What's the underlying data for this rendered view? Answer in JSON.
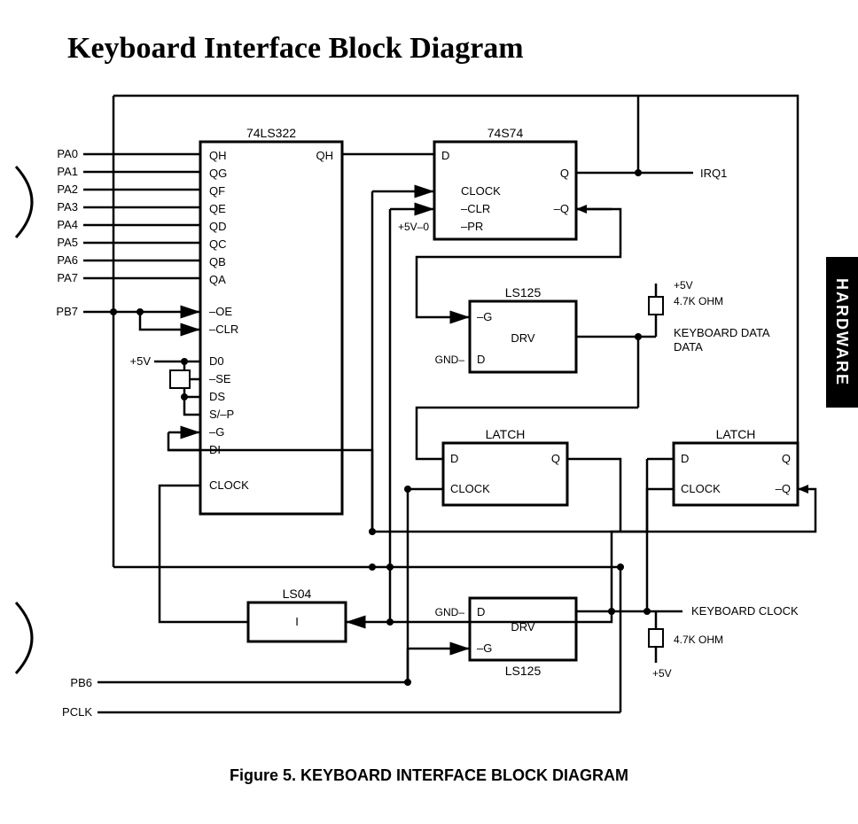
{
  "title": "Keyboard Interface Block Diagram",
  "caption_prefix": "Figure 5.  ",
  "caption_main": "KEYBOARD INTERFACE BLOCK DIAGRAM",
  "side_tab": "HARDWARE",
  "signals": {
    "pa0": "PA0",
    "pa1": "PA1",
    "pa2": "PA2",
    "pa3": "PA3",
    "pa4": "PA4",
    "pa5": "PA5",
    "pa6": "PA6",
    "pa7": "PA7",
    "pb7": "PB7",
    "pb6": "PB6",
    "pclk": "PCLK",
    "irq1": "IRQ1",
    "kb_data": "KEYBOARD\nDATA",
    "kb_clock": "KEYBOARD CLOCK",
    "p5v": "+5V",
    "p5v0": "+5V–0",
    "gnd": "GND–",
    "zero": "0",
    "r47k": "4.7K OHM"
  },
  "chips": {
    "sr": {
      "name": "74LS322",
      "pins": [
        "QH",
        "QH",
        "QG",
        "QF",
        "QE",
        "QD",
        "QC",
        "QB",
        "QA",
        "–OE",
        "–CLR",
        "D0",
        "–SE",
        "DS",
        "S/–P",
        "–G",
        "DI",
        "CLOCK"
      ]
    },
    "ff": {
      "name": "74S74",
      "pins": [
        "D",
        "Q",
        "CLOCK",
        "–CLR",
        "–Q",
        "–PR"
      ]
    },
    "buf1": {
      "name": "LS125",
      "pins": [
        "–G",
        "DRV",
        "D"
      ]
    },
    "latch1": {
      "name": "LATCH",
      "pins": [
        "D",
        "Q",
        "CLOCK"
      ]
    },
    "latch2": {
      "name": "LATCH",
      "pins": [
        "D",
        "Q",
        "CLOCK",
        "–Q"
      ]
    },
    "inv": {
      "name": "LS04",
      "pins": [
        "I"
      ]
    },
    "buf2": {
      "name": "LS125",
      "pins": [
        "D",
        "DRV",
        "–G"
      ]
    }
  }
}
